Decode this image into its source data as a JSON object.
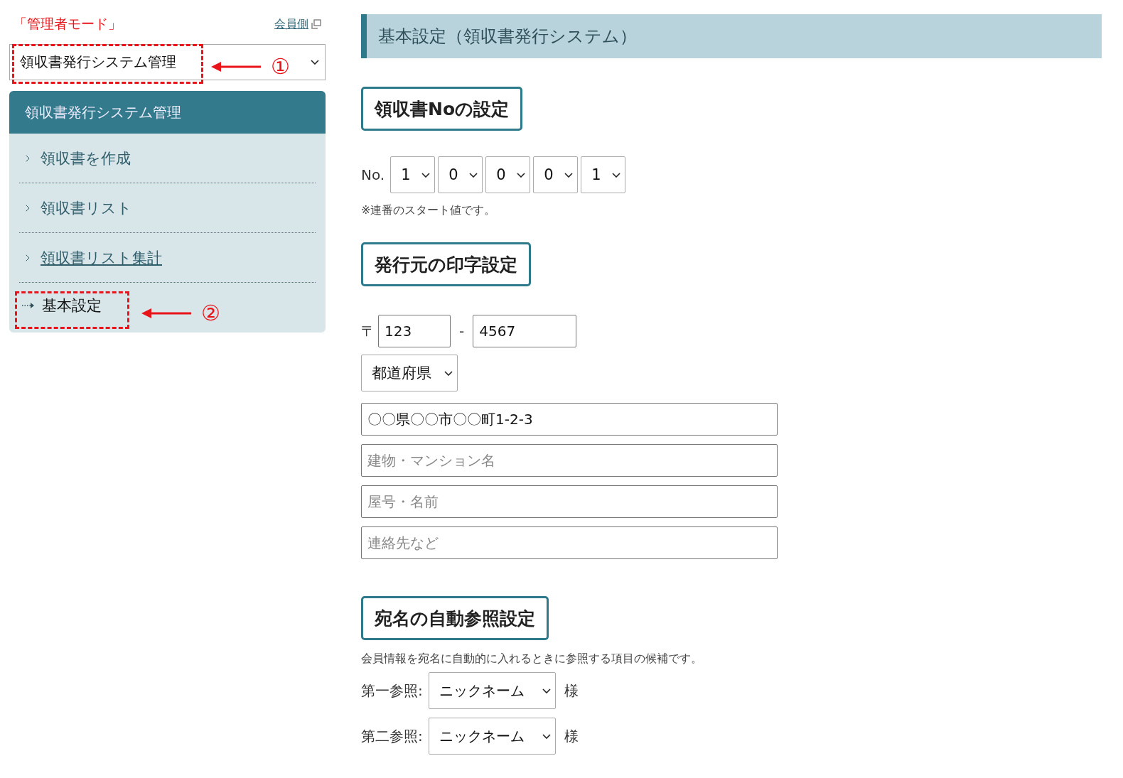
{
  "sidebar": {
    "mode_label": "「管理者モード」",
    "member_link": "会員側",
    "system_select": {
      "value": "領収書発行システム管理"
    },
    "menu": {
      "title": "領収書発行システム管理",
      "items": [
        {
          "label": "領収書を作成",
          "selected": false,
          "hovered": false
        },
        {
          "label": "領収書リスト",
          "selected": false,
          "hovered": false
        },
        {
          "label": "領収書リスト集計",
          "selected": false,
          "hovered": true
        },
        {
          "label": "基本設定",
          "selected": true,
          "hovered": false
        }
      ]
    }
  },
  "annotations": [
    {
      "label": "①"
    },
    {
      "label": "②"
    }
  ],
  "main": {
    "title": "基本設定（領収書発行システム）",
    "receipt_no": {
      "heading": "領収書Noの設定",
      "prefix": "No.",
      "digits": [
        "1",
        "0",
        "0",
        "0",
        "1"
      ],
      "note": "※連番のスタート値です。"
    },
    "issuer": {
      "heading": "発行元の印字設定",
      "postal_mark": "〒",
      "postal_1": "123",
      "postal_sep": "-",
      "postal_2": "4567",
      "prefecture": "都道府県",
      "fields": [
        {
          "value": "〇〇県〇〇市〇〇町1-2-3"
        },
        {
          "placeholder": "建物・マンション名"
        },
        {
          "placeholder": "屋号・名前"
        },
        {
          "placeholder": "連絡先など"
        }
      ]
    },
    "addressee": {
      "heading": "宛名の自動参照設定",
      "description": "会員情報を宛名に自動的に入れるときに参照する項目の候補です。",
      "refs": [
        {
          "label": "第一参照:",
          "value": "ニックネーム",
          "suffix": "様"
        },
        {
          "label": "第二参照:",
          "value": "ニックネーム",
          "suffix": "様"
        }
      ]
    }
  }
}
